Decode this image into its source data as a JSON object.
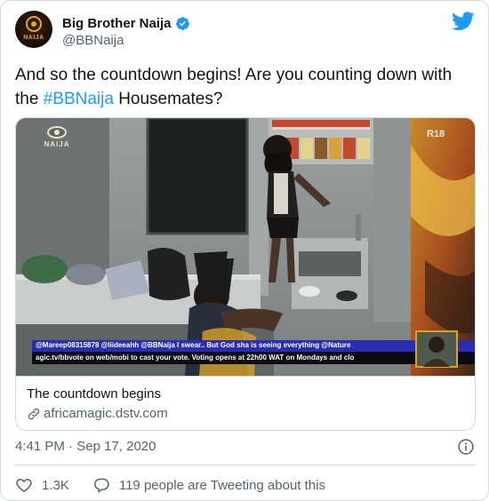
{
  "account": {
    "display_name": "Big Brother Naija",
    "handle": "@BBNaija",
    "avatar_text": "NAIJA",
    "verified": true
  },
  "tweet": {
    "text_before": "And so the countdown begins! Are you counting down with the ",
    "hashtag": "#BBNaija",
    "text_after": " Housemates?"
  },
  "media": {
    "overlay_logo_text": "NAIJA",
    "rating_badge": "R18",
    "ticker_line_1": "@Mareep08315878 @liideeahh @BBNaija I swear.. But God sha is seeing everything  @Nature",
    "ticker_line_2": "agic.tv/bbvote on web/mobi to cast your vote. Voting opens at 22h00 WAT on Mondays and clo"
  },
  "link_card": {
    "title": "The countdown begins",
    "domain": "africamagic.dstv.com"
  },
  "meta": {
    "time": "4:41 PM",
    "separator": " · ",
    "date": "Sep 17, 2020"
  },
  "actions": {
    "likes": "1.3K",
    "conversation": "119 people are Tweeting about this"
  },
  "colors": {
    "accent": "#1d9bf0",
    "text": "#0f1419",
    "secondary": "#536471",
    "border": "#cfd9de"
  }
}
